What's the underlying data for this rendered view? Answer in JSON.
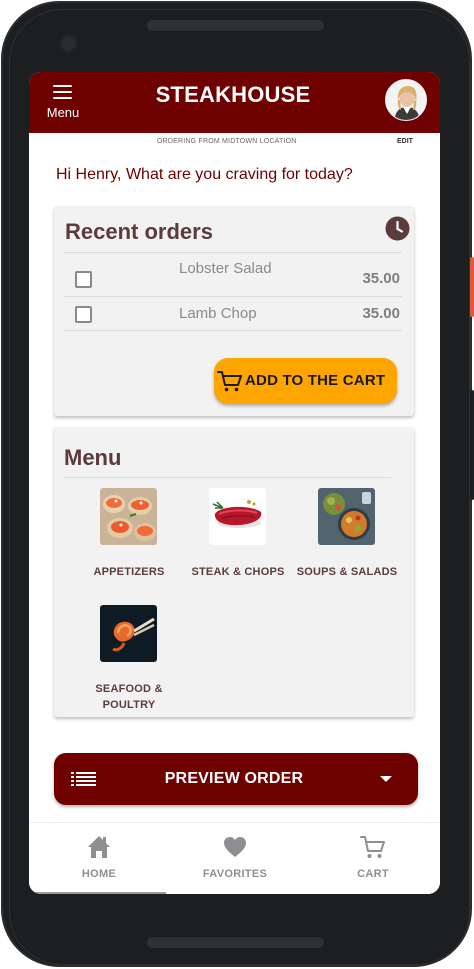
{
  "app": {
    "title": "STEAKHOUSE",
    "menu_label": "Menu",
    "ordering_from": "ORDERING FROM MIDTOWN LOCATION",
    "edit_label": "EDIT",
    "greeting": "Hi Henry, What are you craving for today?"
  },
  "recent_orders": {
    "title": "Recent orders",
    "icon": "clock-icon",
    "items": [
      {
        "name": "Lobster Salad",
        "price": "35.00",
        "checked": false
      },
      {
        "name": "Lamb Chop",
        "price": "35.00",
        "checked": false
      }
    ],
    "add_to_cart_label": "ADD TO THE CART"
  },
  "menu": {
    "title": "Menu",
    "categories": [
      {
        "label": "APPETIZERS",
        "icon": "appetizers-image"
      },
      {
        "label": "STEAK & CHOPS",
        "icon": "steak-image"
      },
      {
        "label": "SOUPS & SALADS",
        "icon": "soups-image"
      },
      {
        "label": "SEAFOOD & POULTRY",
        "icon": "seafood-image"
      }
    ]
  },
  "preview_order": {
    "label": "PREVIEW ORDER",
    "icon": "list-icon"
  },
  "bottom_nav": {
    "items": [
      {
        "label": "HOME",
        "icon": "home-icon",
        "active": true
      },
      {
        "label": "FAVORITES",
        "icon": "heart-icon",
        "active": false
      },
      {
        "label": "CART",
        "icon": "cart-icon",
        "active": false
      }
    ]
  },
  "colors": {
    "brand": "#6e0000",
    "accent": "#ffa500",
    "card_bg": "#f2f2f2",
    "heading": "#5c3b3b",
    "muted": "#8e8e93"
  }
}
